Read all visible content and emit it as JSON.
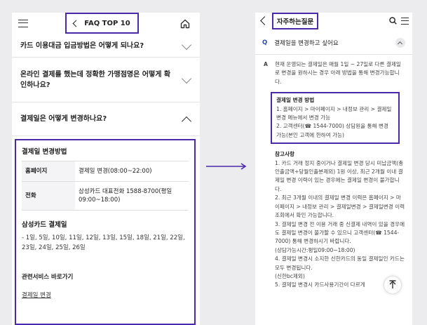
{
  "left": {
    "header_title": "FAQ TOP 10",
    "faq_items": [
      "카드 이용대금 입금방법은 어떻게 되나요?",
      "온라인 결제를 했는데 정확한 가맹점명은 어떻게 확인하나요?",
      "결제일은 어떻게 변경하나요?"
    ],
    "answer": {
      "section_title": "결제일 변경방법",
      "rows": [
        {
          "label": "홈페이지",
          "value": "결제일 변경(08:00~22:00)"
        },
        {
          "label": "전화",
          "value": "삼성카드 대표전화 1588-8700(평일 09:00~18:00)"
        }
      ],
      "samsung_title": "삼성카드 결제일",
      "dates": "- 1일, 5일, 10일, 11일, 12일, 13일, 15일, 18일, 21일, 22일, 23일, 24일, 25일, 26일",
      "related_title": "관련서비스 바로가기",
      "related_link": "결제일 변경"
    }
  },
  "right": {
    "header_title": "자주하는질문",
    "question_mark": "Q",
    "question": "결제일을 변경하고 싶어요",
    "answer_mark": "A",
    "intro": "현재 운영되는 결제일은 매월 1일 ~ 27일로 다른 결제일로 변경을 원하시는 경우 아래 방법을 통해 변경가능합니다.",
    "method_title": "결제일 변경 방법",
    "method_lines": [
      "1. 홈페이지 > 마이페이지 > 내정보 관리 > 결제일변경 메뉴에서 변경 가능",
      "2. 고객센터(☎ 1544-7000) 상담원을 통해 변경 가능(본인 고객에 한하여 가능)"
    ],
    "ref_title": "참고사항",
    "ref_lines": [
      "1. 카드 거래 정지 중이거나 결제일 변경 당시 미납금액(총 인출금액+당월인출분제외) 1원 이상, 최근 2개월 이내 결제일 변경 이력이 있는 경우에는 결제일 변경이 불가합니다.",
      "2. 최근 3개월 이내의 결제일 변경 이력은 홈페이지 > 마이페이지 > 내정보 관리 > 결제일변경 > 결제일변경 이력조회에서 확인 가능합니다.",
      "3. 결제일 변경 전 이용 거래 중 신결제 내역이 있을 경우에도 결제일 변경이 불가할 수 있으니 고객센터(☎ 1544-7000) 통해 변경하시기 바랍니다.",
      "(상담가능시간:평일09:00~18:00)",
      "4. 결제일 변경시 소지한 신한카드의 동일 결제일인 카드는 모두 변경됩니다.",
      "(신한bc제외)",
      "5. 결제일 변경시 카드사용기간이 다르게"
    ]
  }
}
